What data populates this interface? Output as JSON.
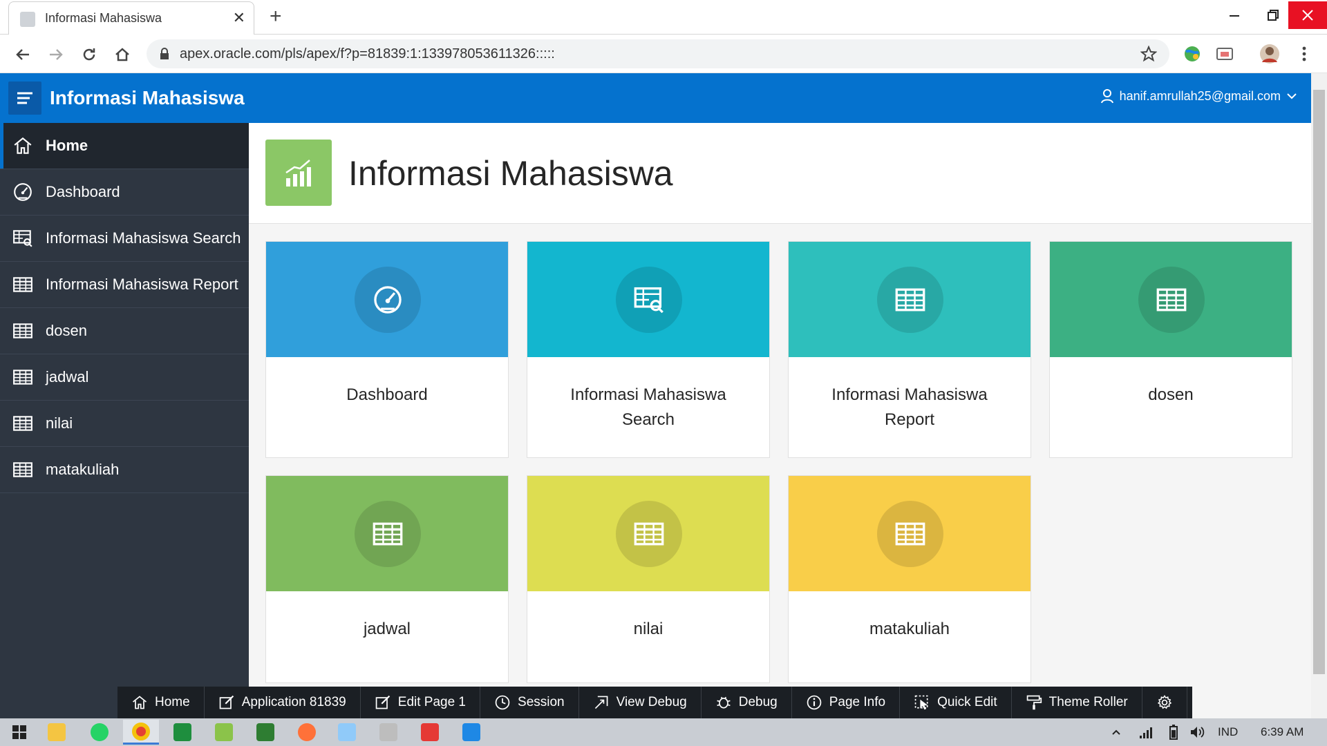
{
  "browser": {
    "tab_title": "Informasi Mahasiswa",
    "tab_close": "✕",
    "new_tab": "+",
    "url": "apex.oracle.com/pls/apex/f?p=81839:1:133978053611326:::::"
  },
  "header": {
    "app_title": "Informasi Mahasiswa",
    "user": "hanif.amrullah25@gmail.com"
  },
  "sidebar": {
    "items": [
      {
        "label": "Home",
        "icon": "home-icon"
      },
      {
        "label": "Dashboard",
        "icon": "gauge-icon"
      },
      {
        "label": "Informasi Mahasiswa Search",
        "icon": "table-search-icon"
      },
      {
        "label": "Informasi Mahasiswa Report",
        "icon": "table-icon"
      },
      {
        "label": "dosen",
        "icon": "table-icon"
      },
      {
        "label": "jadwal",
        "icon": "table-icon"
      },
      {
        "label": "nilai",
        "icon": "table-icon"
      },
      {
        "label": "matakuliah",
        "icon": "table-icon"
      }
    ]
  },
  "hero": {
    "title": "Informasi Mahasiswa",
    "icon": "bar-chart-icon"
  },
  "cards": [
    {
      "label": "Dashboard",
      "label2": "",
      "icon": "gauge-icon",
      "color": "#309fdb",
      "circle": "#2a8cc1"
    },
    {
      "label": "Informasi Mahasiswa",
      "label2": "Search",
      "icon": "table-search-icon",
      "color": "#13b6cf",
      "circle": "#10a0b6"
    },
    {
      "label": "Informasi Mahasiswa",
      "label2": "Report",
      "icon": "table-icon",
      "color": "#2ebfbc",
      "circle": "#28a8a5"
    },
    {
      "label": "dosen",
      "label2": "",
      "icon": "table-icon",
      "color": "#3cb083",
      "circle": "#359b73"
    },
    {
      "label": "jadwal",
      "label2": "",
      "icon": "table-icon",
      "color": "#80bb5e",
      "circle": "#71a553"
    },
    {
      "label": "nilai",
      "label2": "",
      "icon": "table-icon",
      "color": "#dddd51",
      "circle": "#c3c247"
    },
    {
      "label": "matakuliah",
      "label2": "",
      "icon": "table-icon",
      "color": "#f9ce49",
      "circle": "#dbb540"
    }
  ],
  "devbar": [
    {
      "label": "Home",
      "icon": "home-icon"
    },
    {
      "label": "Application 81839",
      "icon": "edit-app-icon"
    },
    {
      "label": "Edit Page 1",
      "icon": "edit-page-icon"
    },
    {
      "label": "Session",
      "icon": "clock-icon"
    },
    {
      "label": "View Debug",
      "icon": "view-debug-icon"
    },
    {
      "label": "Debug",
      "icon": "bug-icon"
    },
    {
      "label": "Page Info",
      "icon": "info-icon"
    },
    {
      "label": "Quick Edit",
      "icon": "quick-edit-icon"
    },
    {
      "label": "Theme Roller",
      "icon": "paint-roller-icon"
    },
    {
      "label": "",
      "icon": "gear-icon"
    }
  ],
  "taskbar": {
    "language": "IND",
    "time": "6:39 AM"
  }
}
